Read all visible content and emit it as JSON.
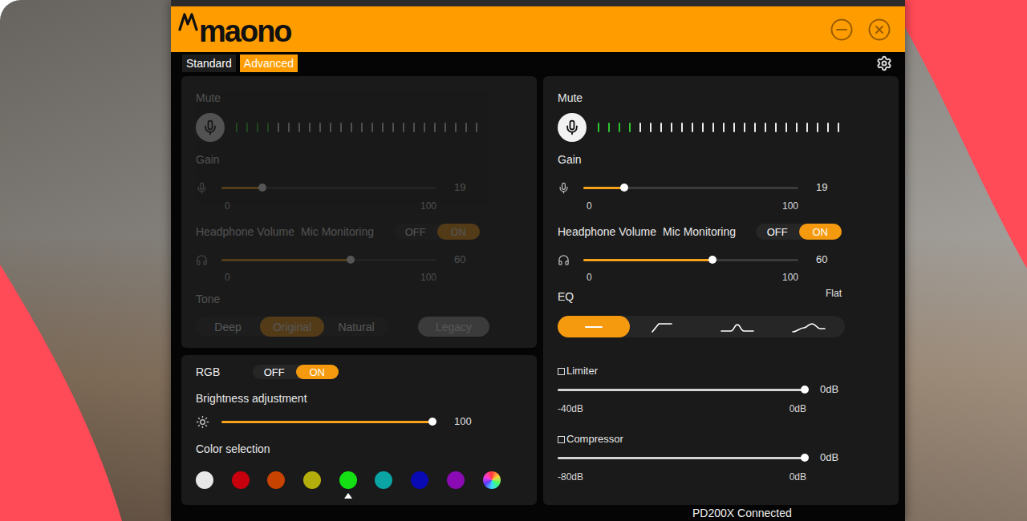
{
  "window": {
    "logo": "maono"
  },
  "tabs": [
    {
      "label": "Standard",
      "selected": false
    },
    {
      "label": "Advanced",
      "selected": true
    }
  ],
  "standard": {
    "disabled": true,
    "mute": {
      "label": "Mute",
      "muted": false
    },
    "meter": {
      "level": 0.16
    },
    "gain": {
      "label": "Gain",
      "level": 0.19,
      "value": "19",
      "min": "0",
      "max": "100"
    },
    "headphone": {
      "label": "Headphone Volume",
      "level": 0.6,
      "value": "60",
      "min": "0",
      "max": "100"
    },
    "monitoring": {
      "label": "Mic Monitoring",
      "options": [
        {
          "label": "OFF",
          "selected": false
        },
        {
          "label": "ON",
          "selected": true
        }
      ]
    },
    "tone": {
      "label": "Tone",
      "options": [
        {
          "label": "Deep",
          "selected": false
        },
        {
          "label": "Original",
          "selected": true
        },
        {
          "label": "Natural",
          "selected": false
        }
      ],
      "legacy": {
        "label": "Legacy",
        "on": false
      }
    }
  },
  "rgb": {
    "label": "RGB",
    "options": [
      {
        "label": "OFF",
        "selected": false
      },
      {
        "label": "ON",
        "selected": true
      }
    ],
    "brightness": {
      "label": "Brightness adjustment",
      "level": 1,
      "value": "100"
    },
    "colors": {
      "label": "Color selection",
      "items": [
        {
          "kind": "solid",
          "color": "#e8e8e8",
          "selected": false
        },
        {
          "kind": "solid",
          "color": "#c8000e",
          "selected": false
        },
        {
          "kind": "solid",
          "color": "#c84300",
          "selected": false
        },
        {
          "kind": "solid",
          "color": "#b4ae0c",
          "selected": false
        },
        {
          "kind": "solid",
          "color": "#14e014",
          "selected": true
        },
        {
          "kind": "solid",
          "color": "#0aa4a4",
          "selected": false
        },
        {
          "kind": "solid",
          "color": "#0a0ab4",
          "selected": false
        },
        {
          "kind": "solid",
          "color": "#8a0ab4",
          "selected": false
        },
        {
          "kind": "spectrum",
          "selected": false
        }
      ]
    }
  },
  "advanced": {
    "disabled": false,
    "mute": {
      "label": "Mute",
      "muted": false
    },
    "meter": {
      "level": 0.16
    },
    "gain": {
      "label": "Gain",
      "level": 0.19,
      "value": "19",
      "min": "0",
      "max": "100"
    },
    "headphone": {
      "label": "Headphone Volume",
      "level": 0.6,
      "value": "60",
      "min": "0",
      "max": "100"
    },
    "monitoring": {
      "label": "Mic Monitoring",
      "options": [
        {
          "label": "OFF",
          "selected": false
        },
        {
          "label": "ON",
          "selected": true
        }
      ]
    },
    "eq": {
      "label": "EQ",
      "preset": "Flat",
      "items": [
        {
          "kind": "flat",
          "selected": true
        },
        {
          "kind": "high-pass",
          "selected": false
        },
        {
          "kind": "mid",
          "selected": false
        },
        {
          "kind": "presence",
          "selected": false
        }
      ]
    },
    "limiter": {
      "label": "Limiter",
      "checked": false,
      "level": 1,
      "value": "0dB",
      "min": "-40dB",
      "max": "0dB"
    },
    "compressor": {
      "label": "Compressor",
      "checked": false,
      "level": 1,
      "value": "0dB",
      "min": "-80dB",
      "max": "0dB"
    }
  },
  "status_bar": {
    "text": "PD200X Connected"
  }
}
